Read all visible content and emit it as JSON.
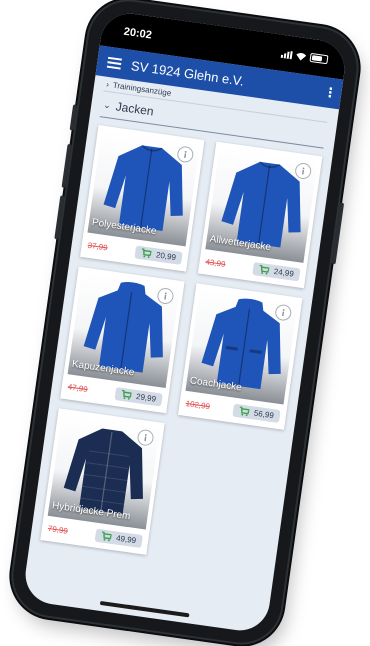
{
  "status_bar": {
    "time": "20:02"
  },
  "app_bar": {
    "title": "SV 1924 Glehn e.V.",
    "menu_icon": "hamburger-menu-icon",
    "more_icon": "more-vertical-icon"
  },
  "breadcrumb": {
    "label": "Trainingsanzüge"
  },
  "section": {
    "title": "Jacken"
  },
  "products": [
    {
      "name": "Polyesterjacke",
      "old_price": "37,99",
      "price": "20,99",
      "jacket_color": "#1f54b8"
    },
    {
      "name": "Allwetterjacke",
      "old_price": "43,99",
      "price": "24,99",
      "jacket_color": "#1f54b8"
    },
    {
      "name": "Kapuzenjacke",
      "old_price": "47,99",
      "price": "29,99",
      "jacket_color": "#1f54b8"
    },
    {
      "name": "Coachjacke",
      "old_price": "102,99",
      "price": "56,99",
      "jacket_color": "#1f54b8"
    },
    {
      "name": "Hybridjacke Prem",
      "old_price": "79,99",
      "price": "49,99",
      "jacket_color": "#1b2d52"
    }
  ],
  "colors": {
    "brand_blue": "#1e4fa8",
    "old_price_red": "#e05050",
    "cart_green": "#3aa04a",
    "background": "#e6ecf4"
  }
}
